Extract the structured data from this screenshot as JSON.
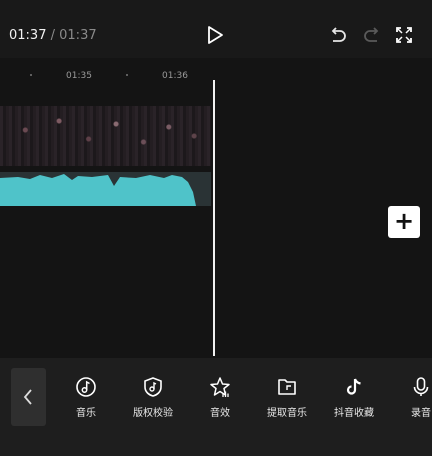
{
  "player": {
    "current_time": "01:37",
    "separator": "/",
    "total_time": "01:37"
  },
  "ruler": {
    "ticks": [
      "01:35",
      "01:36"
    ]
  },
  "toolbar": {
    "items": [
      {
        "label": "音乐",
        "icon": "music-icon"
      },
      {
        "label": "版权校验",
        "icon": "copyright-check-icon"
      },
      {
        "label": "音效",
        "icon": "sound-effect-icon"
      },
      {
        "label": "提取音乐",
        "icon": "extract-music-icon"
      },
      {
        "label": "抖音收藏",
        "icon": "douyin-favorites-icon"
      },
      {
        "label": "录音",
        "icon": "microphone-icon"
      }
    ]
  },
  "icons": {
    "play": "play-icon",
    "undo": "undo-icon",
    "redo": "redo-icon",
    "fullscreen": "fullscreen-icon",
    "add": "plus-icon",
    "back": "chevron-left-icon"
  },
  "colors": {
    "background": "#1a1a1a",
    "waveform": "#4fc3c9",
    "playhead": "#f2f2f2"
  }
}
